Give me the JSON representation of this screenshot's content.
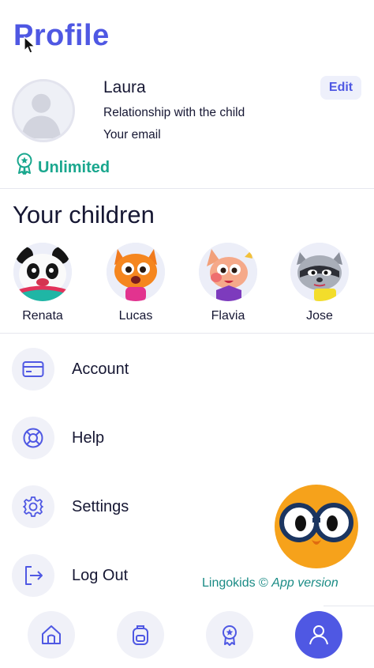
{
  "header": {
    "title": "Profile"
  },
  "profile": {
    "name": "Laura",
    "relationship": "Relationship with the child",
    "email": "Your email",
    "edit_label": "Edit",
    "plan": "Unlimited"
  },
  "children_section": {
    "title": "Your children",
    "children": [
      {
        "name": "Renata"
      },
      {
        "name": "Lucas"
      },
      {
        "name": "Flavia"
      },
      {
        "name": "Jose"
      }
    ]
  },
  "menu": {
    "items": [
      {
        "label": "Account",
        "icon": "card-icon"
      },
      {
        "label": "Help",
        "icon": "lifebuoy-icon"
      },
      {
        "label": "Settings",
        "icon": "gear-icon"
      },
      {
        "label": "Log Out",
        "icon": "logout-icon"
      }
    ]
  },
  "footer": {
    "brand": "Lingokids ©",
    "version_label": "App version"
  },
  "bottom_nav": {
    "items": [
      {
        "icon": "home-icon"
      },
      {
        "icon": "backpack-icon"
      },
      {
        "icon": "award-icon"
      },
      {
        "icon": "profile-icon"
      }
    ]
  },
  "colors": {
    "accent": "#4f58e3",
    "plan_green": "#1aa78e",
    "credit_teal": "#1a8b85"
  }
}
